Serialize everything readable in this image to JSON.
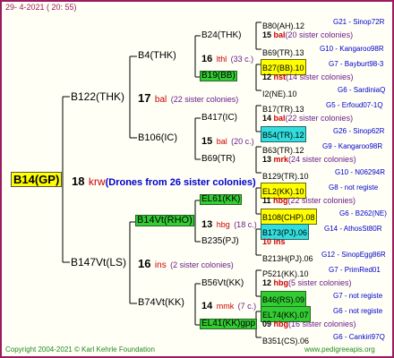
{
  "date": "29- 4-2021 ( 20: 55)",
  "root": {
    "label": "B14(GP)",
    "num": "18",
    "race": "krw",
    "drones": "(Drones from 26 sister colonies)"
  },
  "gen1": [
    {
      "label": "B122(THK)",
      "num": "17",
      "race": "bal",
      "note": "(22 sister colonies)"
    },
    {
      "label": "B147Vt(LS)",
      "num": "16",
      "race": "ins",
      "note": "(2 sister colonies)"
    }
  ],
  "gen2": [
    {
      "label": "B4(THK)",
      "num": "16",
      "race": "lthl",
      "note": "(33 c.)"
    },
    {
      "label": "B106(IC)",
      "num": "15",
      "race": "bal",
      "note": "(20 c.)"
    },
    {
      "label": "B14Vt(RHO)",
      "num": "13",
      "race": "hbg",
      "note": "(18 c.)"
    },
    {
      "label": "B74Vt(KK)",
      "num": "14",
      "race": "mmk",
      "note": "(7 c.)"
    }
  ],
  "gen3": [
    {
      "label": "B24(THK)"
    },
    {
      "label": "B19(BB)"
    },
    {
      "label": "B417(IC)"
    },
    {
      "label": "B69(TR)"
    },
    {
      "label": "EL61(KK)"
    },
    {
      "label": "B235(PJ)"
    },
    {
      "label": "B56Vt(KK)"
    },
    {
      "label": "EL41(KK)gpp"
    }
  ],
  "gen4": [
    {
      "label": "B80(AH).12",
      "ref": "G21 - Sinop72R"
    },
    {
      "label": "15 bal(20 sister colonies)"
    },
    {
      "label": "B69(TR).13",
      "ref": "G10 - Kangaroo98R"
    },
    {
      "label": "B27(BB).10",
      "ref": "G7 - Bayburt98-3"
    },
    {
      "label": "12 nst(14 sister colonies)"
    },
    {
      "label": "I2(NE).10",
      "ref": "G6 - SardiniaQ"
    },
    {
      "label": "B17(TR).13",
      "ref": "G5 - Erfoud07-1Q"
    },
    {
      "label": "14 bal(22 sister colonies)"
    },
    {
      "label": "B54(TR).12",
      "ref": "G26 - Sinop62R"
    },
    {
      "label": "B63(TR).12",
      "ref": "G9 - Kangaroo98R"
    },
    {
      "label": "13 mrk(24 sister colonies)"
    },
    {
      "label": "B129(TR).10",
      "ref": "G10 - N06294R"
    },
    {
      "label": "EL2(KK).10",
      "ref": "G8 - not registe"
    },
    {
      "label": "11 hbg(22 sister colonies)"
    },
    {
      "label": "B108(CHP).08",
      "ref": "G6 - B262(NE)"
    },
    {
      "label": "B173(PJ).06",
      "ref": "G14 - AthosSt80R"
    },
    {
      "label": "10 ins"
    },
    {
      "label": "B213H(PJ).06",
      "ref": "G12 - SinopEgg86R"
    },
    {
      "label": "P521(KK).10",
      "ref": "G7 - PrimRed01"
    },
    {
      "label": "12 hbg(5 sister colonies)"
    },
    {
      "label": "B46(RS).09",
      "ref": "G7 - not registe"
    },
    {
      "label": "EL74(KK).07",
      "ref": "G6 - not registe"
    },
    {
      "label": "09 hbg(16 sister colonies)"
    },
    {
      "label": "B351(CS).06",
      "ref": "G6 - Cankiri97Q"
    }
  ],
  "footer": {
    "copyright": "Copyright 2004-2021 © Karl Kehrle Foundation",
    "url": "www.pedigreeapis.org"
  },
  "colors": {
    "frame": "#9b1b62",
    "lines": "#000000",
    "highlight_green": "#33cc33",
    "highlight_yellow": "#ffff00",
    "highlight_cyan": "#33dddd"
  }
}
